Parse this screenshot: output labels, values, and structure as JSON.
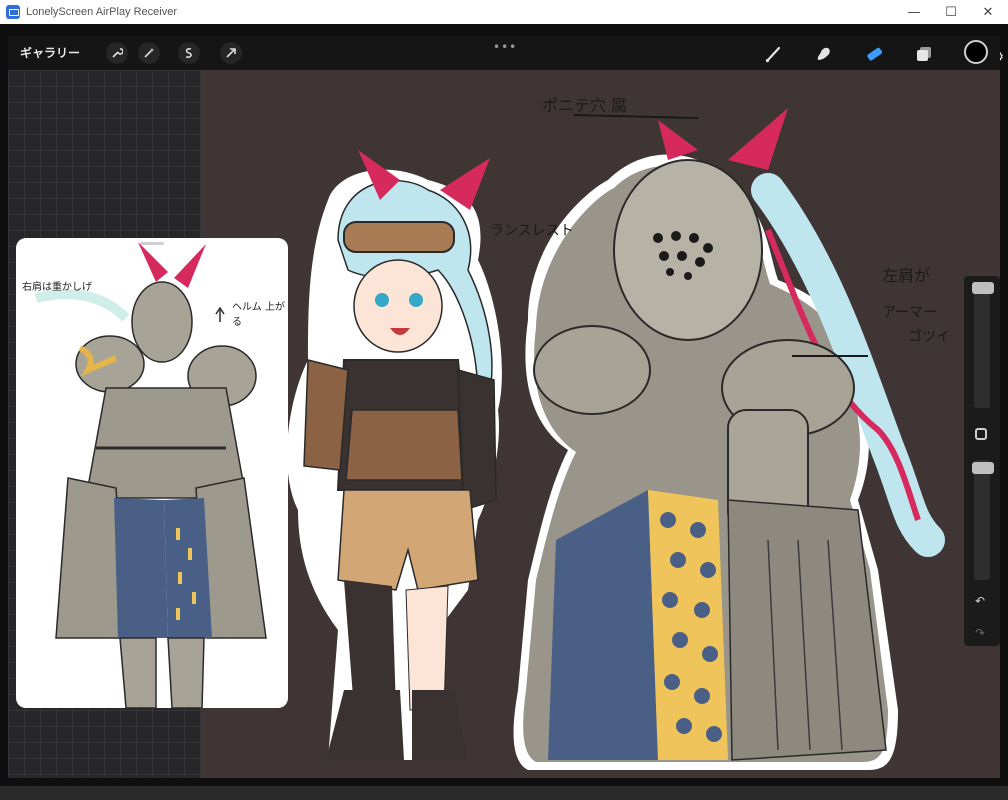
{
  "window": {
    "title": "LonelyScreen AirPlay Receiver",
    "minimize_glyph": "—",
    "maximize_glyph": "☐",
    "close_glyph": "✕"
  },
  "toolbar": {
    "gallery_label": "ギャラリー",
    "left_tools": [
      "wrench-icon",
      "magic-wand-icon",
      "selection-icon",
      "transform-arrow-icon"
    ],
    "handle": "•••",
    "right_tools": [
      "brush-icon",
      "smudge-icon",
      "eraser-icon",
      "layers-icon"
    ],
    "color_well": "#000000",
    "active_tool_color": "#3b9cff"
  },
  "settings_glyph": "⚙",
  "canvas": {
    "notes": {
      "ponytail": "ポニテ穴 腐",
      "lance_rest": "ランスレスト",
      "left_shoulder": "左肩が",
      "armor": "アーマー",
      "rugged": "ゴツイ"
    },
    "reference": {
      "note_right_shoulder": "右肩は重かしげ",
      "note_helmet": "ヘルム 上がる"
    }
  },
  "sidebar": {
    "undo_glyph": "↶",
    "redo_glyph": "↷"
  }
}
